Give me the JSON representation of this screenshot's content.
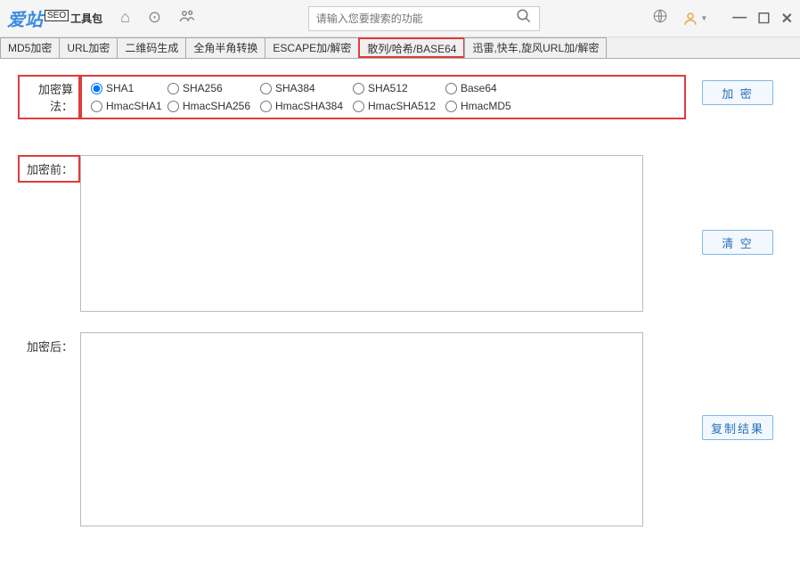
{
  "logo": {
    "main": "爱站",
    "badge": "SEO",
    "suffix": "工具包"
  },
  "search": {
    "placeholder": "请输入您要搜索的功能"
  },
  "tabs": [
    {
      "label": "MD5加密",
      "highlighted": false
    },
    {
      "label": "URL加密",
      "highlighted": false
    },
    {
      "label": "二维码生成",
      "highlighted": false
    },
    {
      "label": "全角半角转换",
      "highlighted": false
    },
    {
      "label": "ESCAPE加/解密",
      "highlighted": false
    },
    {
      "label": "散列/哈希/BASE64",
      "highlighted": true
    },
    {
      "label": "迅雷,快车,旋风URL加/解密",
      "highlighted": false
    }
  ],
  "form": {
    "algorithm_label": "加密算法：",
    "before_label": "加密前：",
    "after_label": "加密后：",
    "radios_row1": [
      {
        "label": "SHA1",
        "checked": true
      },
      {
        "label": "SHA256",
        "checked": false
      },
      {
        "label": "SHA384",
        "checked": false
      },
      {
        "label": "SHA512",
        "checked": false
      },
      {
        "label": "Base64",
        "checked": false
      }
    ],
    "radios_row2": [
      {
        "label": "HmacSHA1",
        "checked": false
      },
      {
        "label": "HmacSHA256",
        "checked": false
      },
      {
        "label": "HmacSHA384",
        "checked": false
      },
      {
        "label": "HmacSHA512",
        "checked": false
      },
      {
        "label": "HmacMD5",
        "checked": false
      }
    ],
    "before_value": "",
    "after_value": ""
  },
  "buttons": {
    "encrypt": "加 密",
    "clear": "清 空",
    "copy": "复制结果"
  }
}
